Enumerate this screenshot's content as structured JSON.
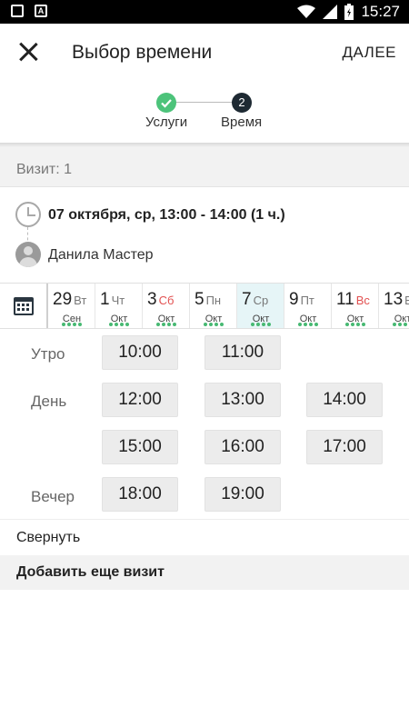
{
  "status_bar": {
    "time": "15:27",
    "icons": [
      "image-icon",
      "font-icon",
      "wifi-icon",
      "signal-icon",
      "battery-icon"
    ]
  },
  "appbar": {
    "title": "Выбор времени",
    "next_label": "ДАЛЕЕ"
  },
  "stepper": {
    "steps": [
      {
        "label": "Услуги",
        "state": "done",
        "marker": "check-icon"
      },
      {
        "label": "Время",
        "state": "current",
        "marker": "2"
      }
    ],
    "done_color": "#4cc37a",
    "current_color": "#1e2a33"
  },
  "visit": {
    "header": "Визит: 1",
    "datetime": "07 октября, ср, 13:00 - 14:00 (1 ч.)",
    "master": "Данила Мастер"
  },
  "calendar": {
    "days": [
      {
        "num": "29",
        "weekday": "Вт",
        "month": "Сен",
        "weekend": false,
        "selected": false
      },
      {
        "num": "1",
        "weekday": "Чт",
        "month": "Окт",
        "weekend": false,
        "selected": false
      },
      {
        "num": "3",
        "weekday": "Сб",
        "month": "Окт",
        "weekend": true,
        "selected": false
      },
      {
        "num": "5",
        "weekday": "Пн",
        "month": "Окт",
        "weekend": false,
        "selected": false
      },
      {
        "num": "7",
        "weekday": "Ср",
        "month": "Окт",
        "weekend": false,
        "selected": true
      },
      {
        "num": "9",
        "weekday": "Пт",
        "month": "Окт",
        "weekend": false,
        "selected": false
      },
      {
        "num": "11",
        "weekday": "Вс",
        "month": "Окт",
        "weekend": true,
        "selected": false
      },
      {
        "num": "13",
        "weekday": "Вт",
        "month": "Окт",
        "weekend": false,
        "selected": false
      }
    ],
    "accent": "#47b973",
    "weekend_color": "#e25151"
  },
  "slots": {
    "morning_label": "Утро",
    "day_label": "День",
    "evening_label": "Вечер",
    "morning": [
      "10:00",
      "11:00"
    ],
    "day": [
      "12:00",
      "13:00",
      "14:00",
      "15:00",
      "16:00",
      "17:00"
    ],
    "evening": [
      "18:00",
      "19:00"
    ]
  },
  "actions": {
    "collapse": "Свернуть",
    "add_visit": "Добавить еще визит"
  }
}
